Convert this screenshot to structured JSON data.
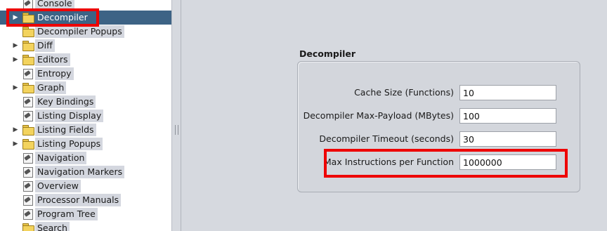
{
  "tree": {
    "items": [
      {
        "label": "Console",
        "type": "leaf",
        "expandable": false,
        "selected": false
      },
      {
        "label": "Decompiler",
        "type": "folder",
        "expandable": true,
        "selected": true
      },
      {
        "label": "Decompiler Popups",
        "type": "folder",
        "expandable": false,
        "selected": false
      },
      {
        "label": "Diff",
        "type": "folder",
        "expandable": true,
        "selected": false
      },
      {
        "label": "Editors",
        "type": "folder",
        "expandable": true,
        "selected": false
      },
      {
        "label": "Entropy",
        "type": "leaf",
        "expandable": false,
        "selected": false
      },
      {
        "label": "Graph",
        "type": "folder",
        "expandable": true,
        "selected": false
      },
      {
        "label": "Key Bindings",
        "type": "leaf",
        "expandable": false,
        "selected": false
      },
      {
        "label": "Listing Display",
        "type": "leaf",
        "expandable": false,
        "selected": false
      },
      {
        "label": "Listing Fields",
        "type": "folder",
        "expandable": true,
        "selected": false
      },
      {
        "label": "Listing Popups",
        "type": "folder",
        "expandable": true,
        "selected": false
      },
      {
        "label": "Navigation",
        "type": "leaf",
        "expandable": false,
        "selected": false
      },
      {
        "label": "Navigation Markers",
        "type": "leaf",
        "expandable": false,
        "selected": false
      },
      {
        "label": "Overview",
        "type": "leaf",
        "expandable": false,
        "selected": false
      },
      {
        "label": "Processor Manuals",
        "type": "leaf",
        "expandable": false,
        "selected": false
      },
      {
        "label": "Program Tree",
        "type": "leaf",
        "expandable": false,
        "selected": false
      },
      {
        "label": "Search",
        "type": "folder",
        "expandable": false,
        "selected": false
      }
    ]
  },
  "options": {
    "title": "Decompiler",
    "fields": [
      {
        "label": "Cache Size (Functions)",
        "value": "10"
      },
      {
        "label": "Decompiler Max-Payload (MBytes)",
        "value": "100"
      },
      {
        "label": "Decompiler Timeout (seconds)",
        "value": "30"
      },
      {
        "label": "Max Instructions per Function",
        "value": "1000000"
      }
    ]
  },
  "colors": {
    "selection": "#3d6385",
    "highlight": "#ee0000",
    "folder": "#f3d35d"
  }
}
